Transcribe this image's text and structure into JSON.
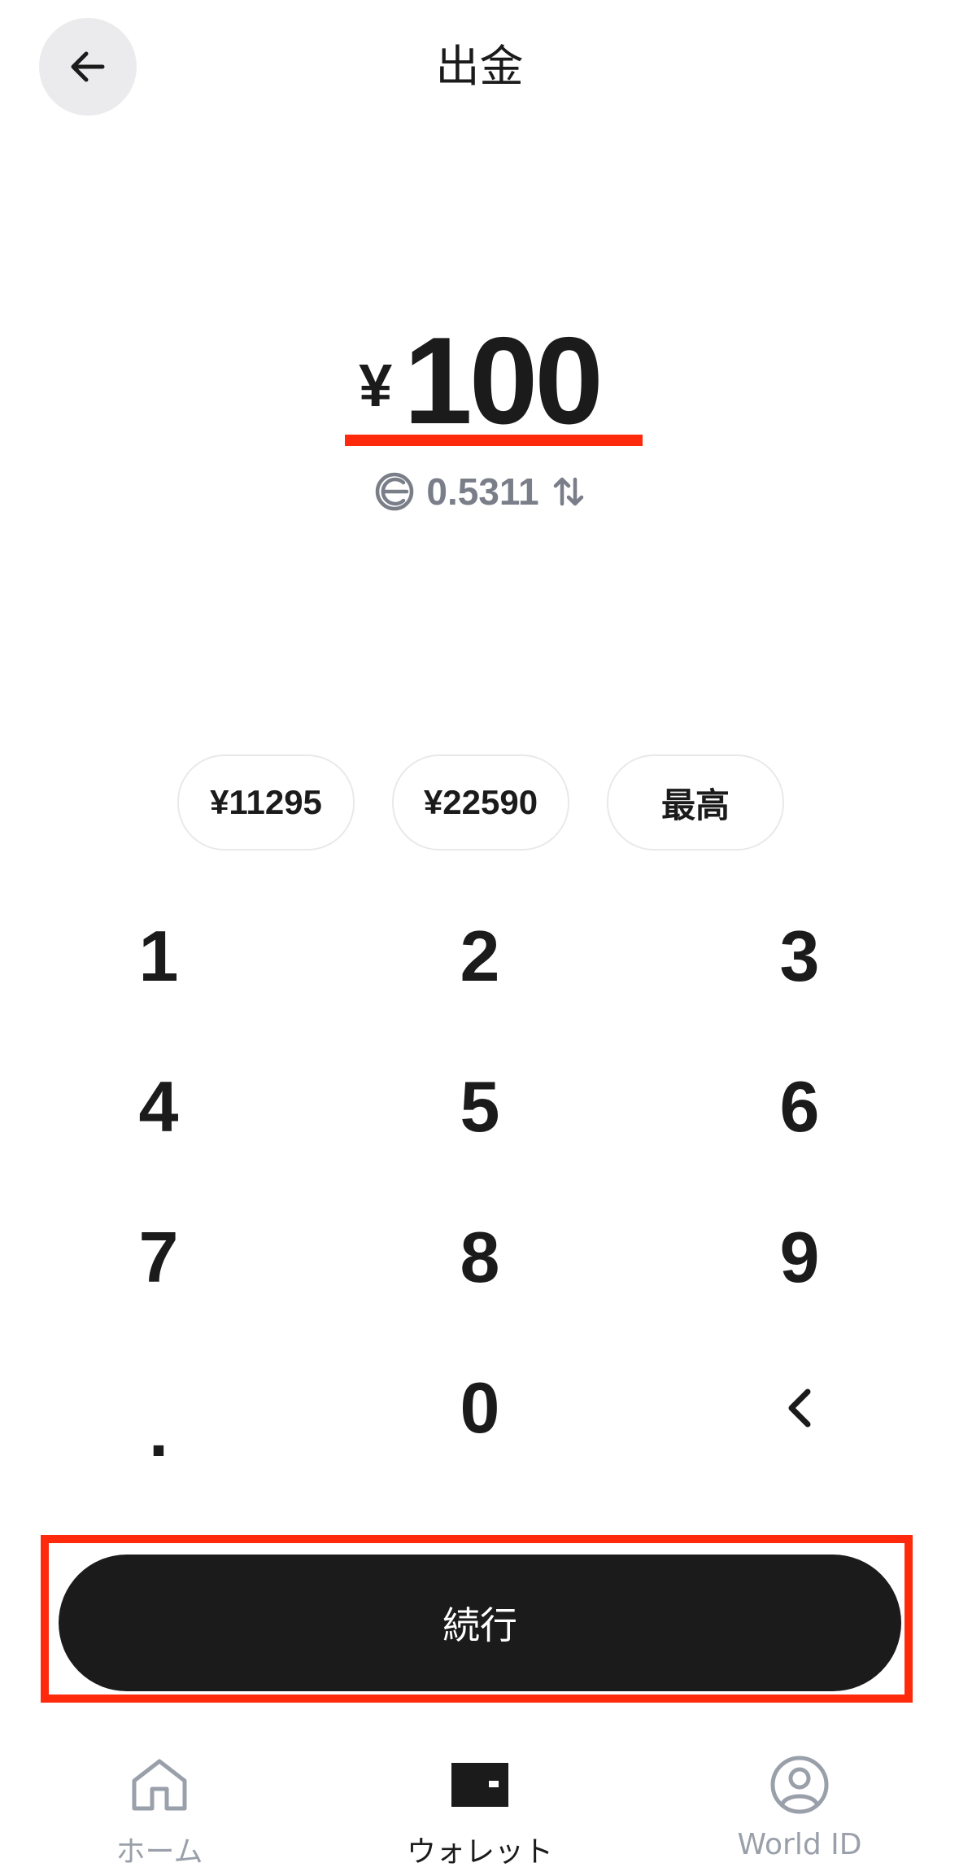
{
  "header": {
    "title": "出金",
    "back_icon": "arrow-left-icon"
  },
  "amount": {
    "currency": "¥",
    "value": "100",
    "underline_color": "#ff2a0c"
  },
  "conversion": {
    "token_icon": "worldcoin-icon",
    "value": "0.5311",
    "swap_icon": "swap-arrows-icon"
  },
  "quick_amounts": [
    {
      "label": "¥11295"
    },
    {
      "label": "¥22590"
    },
    {
      "label": "最高"
    }
  ],
  "keypad": {
    "keys": [
      "1",
      "2",
      "3",
      "4",
      "5",
      "6",
      "7",
      "8",
      "9",
      ".",
      "0",
      "<"
    ]
  },
  "continue_button": {
    "label": "続行",
    "highlight_color": "#ff2a0c"
  },
  "tabbar": {
    "tabs": [
      {
        "label": "ホーム",
        "icon": "home-icon",
        "active": false
      },
      {
        "label": "ウォレット",
        "icon": "wallet-icon",
        "active": true
      },
      {
        "label": "World ID",
        "icon": "world-id-icon",
        "active": false
      }
    ]
  },
  "colors": {
    "text": "#1b1b1b",
    "muted": "#7a7e89",
    "accent_red": "#ff2a0c",
    "button_bg": "#1b1b1b"
  }
}
